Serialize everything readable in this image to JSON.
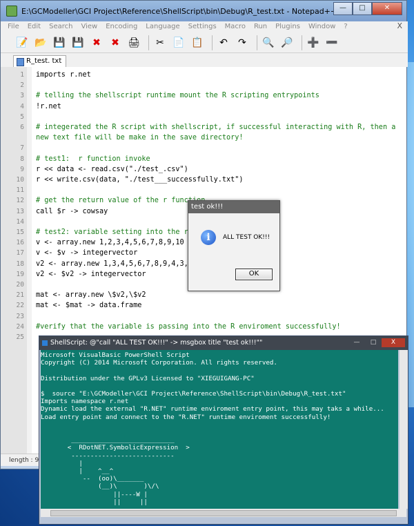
{
  "npp": {
    "title": "E:\\GCModeller\\GCI Project\\Reference\\ShellScript\\bin\\Debug\\R_test.txt - Notepad++",
    "menu": [
      "File",
      "Edit",
      "Search",
      "View",
      "Encoding",
      "Language",
      "Settings",
      "Macro",
      "Run",
      "Plugins",
      "Window",
      "?"
    ],
    "menu_close": "X",
    "tab_label": "R_test. txt",
    "status_text": "length : 91"
  },
  "code_lines": [
    {
      "n": "1",
      "t": "imports r.net",
      "c": "kw"
    },
    {
      "n": "2",
      "t": "",
      "c": "kw"
    },
    {
      "n": "3",
      "t": "# telling the shellscript runtime mount the R scripting entrypoints",
      "c": "cmt"
    },
    {
      "n": "4",
      "t": "!r.net",
      "c": "kw"
    },
    {
      "n": "5",
      "t": "",
      "c": "kw"
    },
    {
      "n": "6",
      "t": "# integerated the R script with shellscript, if successful interacting with R, then a",
      "c": "cmt"
    },
    {
      "n": "",
      "t": "new text file will be make in the save directory!",
      "c": "cmt"
    },
    {
      "n": "7",
      "t": "",
      "c": "kw"
    },
    {
      "n": "8",
      "t": "# test1:  r function invoke",
      "c": "cmt"
    },
    {
      "n": "9",
      "t": "r << data <- read.csv(\"./test_.csv\")",
      "c": "kw"
    },
    {
      "n": "10",
      "t": "r << write.csv(data, \"./test___successfully.txt\")",
      "c": "kw"
    },
    {
      "n": "11",
      "t": "",
      "c": "kw"
    },
    {
      "n": "12",
      "t": "# get the return value of the r function",
      "c": "cmt"
    },
    {
      "n": "13",
      "t": "call $r -> cowsay",
      "c": "kw"
    },
    {
      "n": "14",
      "t": "",
      "c": "kw"
    },
    {
      "n": "15",
      "t": "# test2: variable setting into the r env",
      "c": "cmt"
    },
    {
      "n": "16",
      "t": "v <- array.new 1,2,3,4,5,6,7,8,9,10",
      "c": "kw"
    },
    {
      "n": "17",
      "t": "v <- $v -> integervector",
      "c": "kw"
    },
    {
      "n": "18",
      "t": "v2 <- array.new 1,3,4,5,6,7,8,9,4,3,2,2",
      "c": "kw"
    },
    {
      "n": "19",
      "t": "v2 <- $v2 -> integervector",
      "c": "kw"
    },
    {
      "n": "20",
      "t": "",
      "c": "kw"
    },
    {
      "n": "21",
      "t": "mat <- array.new \\$v2,\\$v2",
      "c": "kw"
    },
    {
      "n": "22",
      "t": "mat <- $mat -> data.frame",
      "c": "kw"
    },
    {
      "n": "23",
      "t": "",
      "c": "kw"
    },
    {
      "n": "24",
      "t": "#verify that the variable is passing into the R enviroment successfully!",
      "c": "cmt"
    },
    {
      "n": "25",
      "t": "",
      "c": "kw"
    }
  ],
  "msgbox": {
    "title": "test ok!!!",
    "text": "ALL TEST OK!!!",
    "ok_label": "OK",
    "icon": "info-icon"
  },
  "ps": {
    "title": "ShellScript: @\"call \"ALL TEST OK!!!\" -> msgbox title \"test ok!!!\"\"",
    "btn_min": "—",
    "btn_max": "□",
    "btn_close": "X",
    "lines": [
      "Microsoft VisualBasic PowerShell Script",
      "Copyright (C) 2014 Microsoft Corporation. All rights reserved.",
      "",
      "Distribution under the GPLv3 Licensed to \"XIEGUIGANG-PC\"",
      "",
      "$  source \"E:\\GCModeller\\GCI Project\\Reference\\ShellScript\\bin\\Debug\\R_test.txt\"",
      "Imports namespace r.net",
      "Dynamic load the external \"R.NET\" runtime enviroment entry point, this may taks a while...",
      "Load entry point and connect to the \"R.NET\" runtime enviroment successfully!",
      "",
      "",
      "        ___________________________",
      "       <  RDotNET.SymbolicExpression  >",
      "        ---------------------------",
      "          |",
      "          |    ^__^",
      "           --  (oo)\\_______",
      "               (__)\\       )\\/\\",
      "                   ||----W |",
      "                   ||     ||"
    ]
  }
}
